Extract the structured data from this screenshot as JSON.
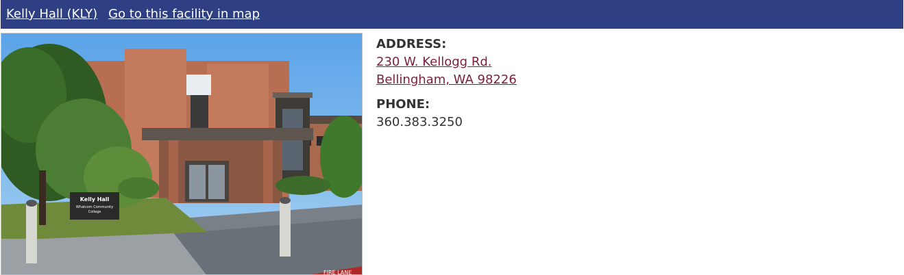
{
  "header": {
    "facility_name": "Kelly Hall (KLY)",
    "map_link": "Go to this facility in map"
  },
  "photo": {
    "sign_line1": "Kelly Hall",
    "sign_line2": "Whatcom Community",
    "sign_line3": "College",
    "road_text": "FIRE LANE"
  },
  "address": {
    "label": "ADDRESS:",
    "line1": "230 W. Kellogg Rd.",
    "line2": "Bellingham, WA 98226"
  },
  "phone": {
    "label": "PHONE:",
    "value": "360.383.3250"
  },
  "colors": {
    "header_bg": "#2e3f84",
    "link": "#7b1f3a",
    "text": "#333333"
  }
}
